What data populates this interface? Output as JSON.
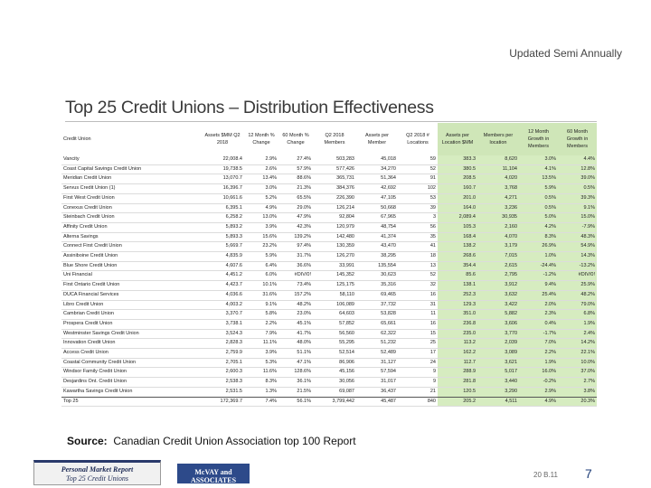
{
  "header": {
    "note": "Updated Semi Annually",
    "title": "Top 25 Credit Unions – Distribution Effectiveness"
  },
  "table": {
    "columns": [
      "Credit Union",
      "Assets $MM Q2 2018",
      "12 Month % Change",
      "60 Month % Change",
      "Q2 2018 Members",
      "Assets per Member",
      "Q2 2018 # Locations",
      "Assets per Location $MM",
      "Members per location",
      "12 Month Growth in Members",
      "60 Month Growth in Members"
    ],
    "rows": [
      [
        "Vancity",
        "22,008.4",
        "2.9%",
        "27.4%",
        "503,283",
        "45,018",
        "59",
        "383.3",
        "8,620",
        "3.0%",
        "4.4%"
      ],
      [
        "Coast Capital Savings Credit Union",
        "19,738.5",
        "2.6%",
        "57.9%",
        "577,426",
        "34,270",
        "52",
        "380.5",
        "11,104",
        "4.1%",
        "12.8%"
      ],
      [
        "Meridian Credit Union",
        "13,070.7",
        "13.4%",
        "88.6%",
        "365,731",
        "51,364",
        "91",
        "208.5",
        "4,020",
        "13.5%",
        "39.0%"
      ],
      [
        "Servus Credit Union (1)",
        "16,396.7",
        "3.0%",
        "21.3%",
        "384,376",
        "42,692",
        "102",
        "160.7",
        "3,768",
        "5.9%",
        "0.5%"
      ],
      [
        "First West Credit Union",
        "10,661.6",
        "5.2%",
        "65.5%",
        "226,390",
        "47,105",
        "53",
        "201.0",
        "4,271",
        "0.5%",
        "39.3%"
      ],
      [
        "Conexus Credit Union",
        "6,395.1",
        "4.9%",
        "29.0%",
        "126,214",
        "50,668",
        "39",
        "164.0",
        "3,236",
        "0.5%",
        "9.1%"
      ],
      [
        "Steinbach Credit Union",
        "6,258.2",
        "13.0%",
        "47.9%",
        "92,804",
        "67,965",
        "3",
        "2,089.4",
        "30,935",
        "5.0%",
        "15.0%"
      ],
      [
        "Affinity Credit Union",
        "5,893.2",
        "3.9%",
        "42.3%",
        "120,979",
        "48,754",
        "56",
        "105.3",
        "2,160",
        "4.2%",
        "-7.9%"
      ],
      [
        "Alterna Savings",
        "5,893.3",
        "15.6%",
        "139.2%",
        "142,480",
        "41,374",
        "35",
        "168.4",
        "4,070",
        "8.3%",
        "48.3%"
      ],
      [
        "Connect First Credit Union",
        "5,669.7",
        "23.2%",
        "97.4%",
        "130,359",
        "43,470",
        "41",
        "138.2",
        "3,179",
        "26.9%",
        "54.9%"
      ],
      [
        "Assiniboine Credit Union",
        "4,835.9",
        "5.9%",
        "31.7%",
        "126,270",
        "38,295",
        "18",
        "268.6",
        "7,015",
        "1.0%",
        "14.3%"
      ],
      [
        "Blue Shore Credit Union",
        "4,607.6",
        "6.4%",
        "36.6%",
        "33,991",
        "135,554",
        "13",
        "354.4",
        "2,615",
        "-24.4%",
        "-13.2%"
      ],
      [
        "Uni Financial",
        "4,451.2",
        "6.0%",
        "#DIV/0!",
        "145,352",
        "30,623",
        "52",
        "85.6",
        "2,795",
        "-1.2%",
        "#DIV/0!"
      ],
      [
        "First Ontario Credit Union",
        "4,423.7",
        "10.1%",
        "73.4%",
        "125,175",
        "35,316",
        "32",
        "138.1",
        "3,912",
        "9.4%",
        "25.9%"
      ],
      [
        "DUCA Financial Services",
        "4,036.6",
        "31.6%",
        "157.2%",
        "58,110",
        "69,465",
        "16",
        "252.3",
        "3,632",
        "25.4%",
        "48.2%"
      ],
      [
        "Libro Credit Union",
        "4,003.2",
        "9.1%",
        "48.2%",
        "106,089",
        "37,732",
        "31",
        "129.3",
        "3,422",
        "2.0%",
        "79.0%"
      ],
      [
        "Cambrian Credit Union",
        "3,370.7",
        "5.8%",
        "23.0%",
        "64,603",
        "53,828",
        "11",
        "351.0",
        "5,882",
        "2.3%",
        "6.8%"
      ],
      [
        "Prospera Credit Union",
        "3,738.1",
        "2.2%",
        "45.1%",
        "57,852",
        "65,661",
        "16",
        "236.8",
        "3,606",
        "0.4%",
        "1.9%"
      ],
      [
        "Westminster Savings Credit Union",
        "3,524.3",
        "7.9%",
        "41.7%",
        "56,560",
        "62,322",
        "15",
        "235.0",
        "3,770",
        "-1.7%",
        "2.4%"
      ],
      [
        "Innovation Credit Union",
        "2,828.3",
        "11.1%",
        "48.0%",
        "55,295",
        "51,232",
        "25",
        "113.2",
        "2,039",
        "7.0%",
        "14.2%"
      ],
      [
        "Access Credit Union",
        "2,759.9",
        "3.9%",
        "51.1%",
        "52,514",
        "52,489",
        "17",
        "162.2",
        "3,089",
        "2.2%",
        "22.1%"
      ],
      [
        "Coastal Community Credit Union",
        "2,705.1",
        "5.3%",
        "47.1%",
        "86,906",
        "31,127",
        "24",
        "112.7",
        "3,621",
        "1.9%",
        "10.0%"
      ],
      [
        "Windsor Family Credit Union",
        "2,600.3",
        "11.6%",
        "128.6%",
        "45,156",
        "57,594",
        "9",
        "288.9",
        "5,017",
        "16.0%",
        "37.0%"
      ],
      [
        "Desjardins Ont. Credit Union",
        "2,538.3",
        "8.3%",
        "36.1%",
        "30,056",
        "31,017",
        "9",
        "281.8",
        "3,440",
        "-0.2%",
        "2.7%"
      ],
      [
        "Kawartha Savings Credit Union",
        "2,531.5",
        "1.3%",
        "21.5%",
        "69,087",
        "36,437",
        "21",
        "120.5",
        "3,290",
        "2.9%",
        "3.8%"
      ]
    ],
    "total": [
      "Top 25",
      "172,369.7",
      "7.4%",
      "56.1%",
      "3,799,442",
      "45,487",
      "840",
      "205.2",
      "4,511",
      "4.9%",
      "20.3%"
    ]
  },
  "source": {
    "label": "Source:",
    "text": "Canadian Credit Union Association top 100 Report"
  },
  "footer": {
    "product_line1": "Personal Market Report",
    "product_line2": "Top 25 Credit Unions",
    "brand": "McVAY and ASSOCIATES",
    "date": "20 B.11",
    "page": "7"
  },
  "colors": {
    "highlight_header": "#cfe6b8",
    "highlight_cell": "#d6ecc0",
    "brand_blue": "#2d4a8a"
  }
}
